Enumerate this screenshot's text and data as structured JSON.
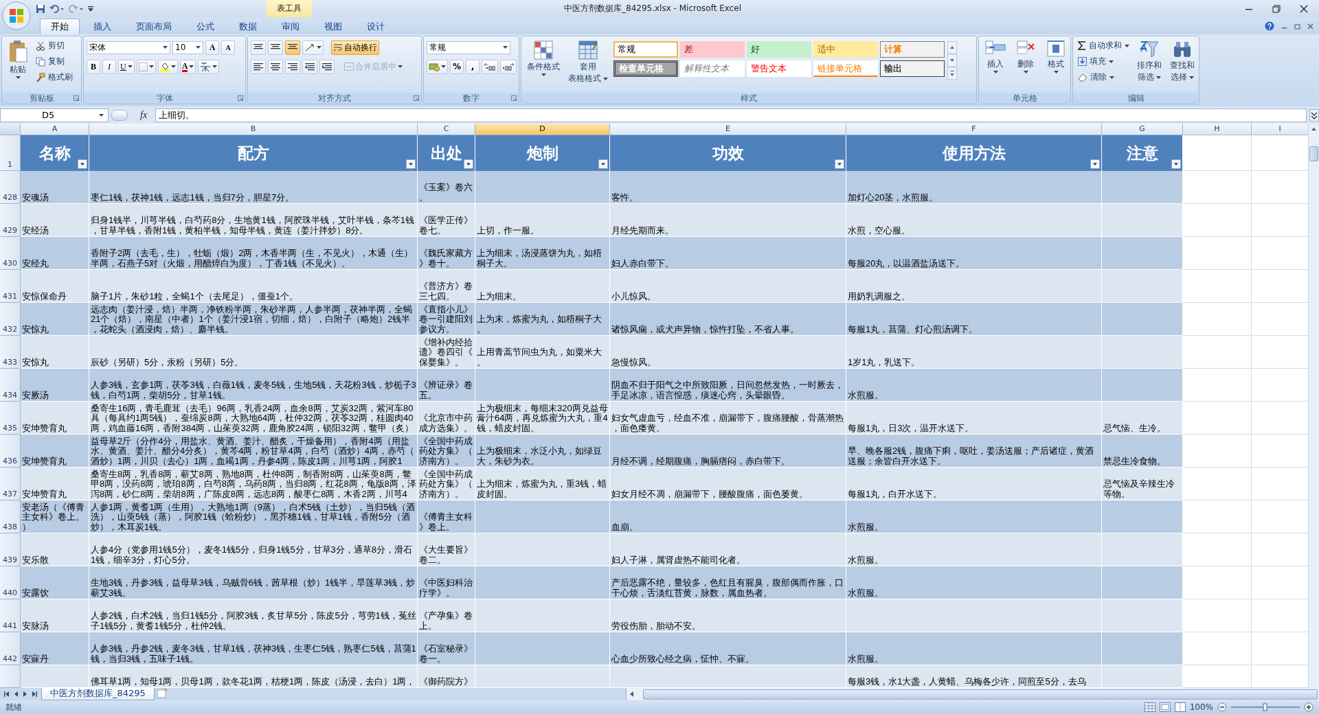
{
  "title_bar": {
    "title": "中医方剂数据库_84295.xlsx - Microsoft Excel",
    "contextual_group": "表工具"
  },
  "ribbon_tabs": [
    {
      "label": "开始",
      "selected": true
    },
    {
      "label": "插入",
      "selected": false
    },
    {
      "label": "页面布局",
      "selected": false
    },
    {
      "label": "公式",
      "selected": false
    },
    {
      "label": "数据",
      "selected": false
    },
    {
      "label": "审阅",
      "selected": false
    },
    {
      "label": "视图",
      "selected": false
    },
    {
      "label": "设计",
      "selected": false
    }
  ],
  "ribbon": {
    "clipboard": {
      "label": "剪贴板",
      "paste": "粘贴",
      "cut": "剪切",
      "copy": "复制",
      "format_painter": "格式刷"
    },
    "font": {
      "label": "字体",
      "font_name": "宋体",
      "font_size": "10",
      "grow": "A",
      "shrink": "A",
      "bold": "B",
      "italic": "I",
      "underline": "U",
      "font_color": "A"
    },
    "alignment": {
      "label": "对齐方式",
      "wrap_text": {
        "label": "自动换行",
        "on": true
      },
      "merge_center": {
        "label": "合并后居中",
        "disabled": true
      }
    },
    "number": {
      "label": "数字",
      "format": "常规",
      "percent": "%",
      "comma": ","
    },
    "styles": {
      "label": "样式",
      "conditional": "条件格式",
      "table_format": [
        "套用",
        "表格格式"
      ],
      "cell_styles": [
        {
          "label": "常规",
          "kind": "normal",
          "selected": true
        },
        {
          "label": "差",
          "kind": "bad",
          "selected": false
        },
        {
          "label": "好",
          "kind": "good",
          "selected": false
        },
        {
          "label": "适中",
          "kind": "neutral",
          "selected": false
        },
        {
          "label": "计算",
          "kind": "calculation",
          "selected": false
        },
        {
          "label": "检查单元格",
          "kind": "check",
          "selected": false
        },
        {
          "label": "解释性文本",
          "kind": "explanatory",
          "selected": false
        },
        {
          "label": "警告文本",
          "kind": "warning",
          "selected": false
        },
        {
          "label": "链接单元格",
          "kind": "linked",
          "selected": false
        },
        {
          "label": "输出",
          "kind": "output",
          "selected": false
        }
      ]
    },
    "cells": {
      "label": "单元格",
      "insert": "插入",
      "delete": "删除",
      "format": "格式"
    },
    "editing": {
      "label": "编辑",
      "autosum": "自动求和",
      "fill": "填充",
      "clear": "清除",
      "sort_filter": [
        "排序和",
        "筛选"
      ],
      "find_select": [
        "查找和",
        "选择"
      ]
    }
  },
  "formula_bar": {
    "name_box": "D5",
    "function_label": "fx",
    "value": "上细切。"
  },
  "column_letters": [
    {
      "letter": "A",
      "selected": false
    },
    {
      "letter": "B",
      "selected": false
    },
    {
      "letter": "C",
      "selected": false
    },
    {
      "letter": "D",
      "selected": true
    },
    {
      "letter": "E",
      "selected": false
    },
    {
      "letter": "F",
      "selected": false
    },
    {
      "letter": "G",
      "selected": false
    },
    {
      "letter": "H",
      "selected": false
    },
    {
      "letter": "I",
      "selected": false
    }
  ],
  "table": {
    "header_row_number": "1",
    "columns": [
      "名称",
      "配方",
      "出处",
      "炮制",
      "功效",
      "使用方法",
      "注意"
    ],
    "rows": [
      {
        "number": "428",
        "name": "安魂汤",
        "recipe": "枣仁1钱，茯神1钱，远志1钱，当归7分，胆星7分。",
        "source": "《玉案》卷六。",
        "efficacy": "客忤。",
        "usage": "加灯心20茎，水煎服。"
      },
      {
        "number": "429",
        "name": "安经汤",
        "recipe": "归身1钱半，川芎半钱，白芍药8分，生地黄1钱，阿胶珠半钱，艾叶半钱，条芩1钱，甘草半钱，香附1钱，黄柏半钱，知母半钱，黄连（姜汁拌炒）8分。",
        "source": "《医学正传》卷七。",
        "preparation": "上切，作一服。",
        "efficacy": "月经先期而来。",
        "usage": "水煎，空心服。"
      },
      {
        "number": "430",
        "name": "安经丸",
        "recipe": "香附子2两（去毛，生），牡蛎（煅）2两，木香半两（生，不见火），木通（生）半两，石燕子5对（火煅，用醋焠白为度），丁香1钱（不见火）。",
        "source": "《魏氏家藏方》卷十。",
        "preparation": "上为细末，汤浸蒸饼为丸，如梧桐子大。",
        "efficacy": "妇人赤白带下。",
        "usage": "每服20丸，以温酒盐汤送下。"
      },
      {
        "number": "431",
        "name": "安惊保命丹",
        "recipe": "脑子1片，朱砂1粒，全蝎1个（去尾足），僵蚕1个。",
        "source": "《普济方》卷三七四。",
        "preparation": "上为细末。",
        "efficacy": "小儿惊风。",
        "usage": "用奶乳调服之。"
      },
      {
        "number": "432",
        "name": "安惊丸",
        "recipe": "远志肉（姜汁浸，焙）半两，净铁粉半两，朱砂半两，人参半两，茯神半两，全蝎21个（焙），南星（中者）1个（姜汁浸1宿，切细，焙），白附子（略炮）2钱半，花蛇头（酒浸肉，焙）、麝半钱。",
        "source": "《直指小儿》卷一引建阳刘参议方。",
        "preparation": "上为末，炼蜜为丸，如梧桐子大。",
        "efficacy": "诸惊风痫，或犬声异物，惊忤打坠，不省人事。",
        "usage": "每服1丸，菖蒲、灯心煎汤调下。"
      },
      {
        "number": "433",
        "name": "安惊丸",
        "recipe": "辰砂（另研）5分，汞粉（另研）5分。",
        "source": "《增补内经拾遗》卷四引《保婴集》。",
        "preparation": "上用青蒿节间虫为丸，如粟米大。",
        "efficacy": "急慢惊风。",
        "usage": "1岁1丸，乳送下。"
      },
      {
        "number": "434",
        "name": "安厥汤",
        "recipe": "人参3钱，玄参1两，茯苓3钱，白薇1钱，麦冬5钱，生地5钱，天花粉3钱，炒栀子3钱，白芍1两，柴胡5分，甘草1钱。",
        "source": "《辨证录》卷五。",
        "efficacy": "阴血不归于阳气之中所致阳厥，日间忽然发热，一时厥去，手足冰凉，语言惶惑，痰迷心窍，头晕眼昏。",
        "usage": "水煎服。"
      },
      {
        "number": "435",
        "name": "安坤赞育丸",
        "recipe": "桑寄生16两，青毛鹿茸（去毛）96两，乳香24两，血余8两，艾炭32两，紫河车80具（每具约1两5钱），蚕绵炭8两，大熟地64两，杜仲32两，茯苓32两，桂圆肉40两，鸡血藤16两，香附384两，山茱萸32两，鹿角胶24两，锁阳32两，鳖甲（炙）",
        "source": "《北京市中药成方选集》。",
        "preparation": "上为极细末，每细末320两兑益母膏汁64两，再兑炼蜜为大丸，重4钱，蜡皮封固。",
        "efficacy": "妇女气虚血亏，经血不准，崩漏带下，腹痛腰酸，骨蒸潮热，面色痿黄。",
        "usage": "每服1丸，日3次，温开水送下。",
        "caution": "忌气恼、生冷。"
      },
      {
        "number": "436",
        "name": "安坤赞育丸",
        "recipe": "益母草2斤（分作4分，用盐水、黄酒、姜汁、醋炙，干燥备用），香附4两（用盐水、黄酒、姜汁、醋分4分炙），黄芩4两，粉甘草4两，白芍（酒炒）4两，赤芍（酒炒）1两，川贝（去心）1两，血竭1两，丹参4两，陈皮1两，川芎1两，阿胶1",
        "source": "《全国中药成药处方集》（济南方）。",
        "preparation": "上为极细末，水泛小丸，如绿豆大，朱砂为衣。",
        "efficacy": "月经不调，经期腹痛，胸膈痞闷，赤白带下。",
        "usage": "早、晚各服2钱，腹痛下痢，呕吐，姜汤送服；产后诸症，黄酒送服；余皆白开水送下。",
        "caution": "禁忌生冷食物。"
      },
      {
        "number": "437",
        "name": "安坤赞育丸",
        "recipe": "桑寄生8两，乳香8两，蕲艾8两，熟地8两，杜仲8两，制香附8两，山茱萸8两，鳖甲8两，没药8两，琥珀8两，白芍8两，乌药8两，当归8两，红花8两，龟版8两，泽泻8两，砂仁8两，柴胡8两，广陈皮8两，远志8两，酸枣仁8两，木香2两，川芎4",
        "source": "《全国中药成药处方集》（济南方）。",
        "preparation": "上为细末，炼蜜为丸，重3钱，蜡皮封固。",
        "efficacy": "妇女月经不凋，崩漏带下，腰酸腹痛，面色萎黄。",
        "usage": "每服1丸，白开水送下。",
        "caution": "忌气恼及辛辣生冷等物。"
      },
      {
        "number": "438",
        "name": "安老汤（《傅青主女科》卷上。）",
        "recipe": "人参1两，黄耆1两（生用），大熟地1两（9蒸），白术5钱（土炒），当归5钱（酒洗），山萸5钱（蒸），阿胶1钱（蛤粉炒），黑芥穗1钱，甘草1钱，香附5分（酒炒），木耳炭1钱。",
        "source": "《傅青主女科》卷上。",
        "efficacy": "血崩。",
        "usage": "水煎服。"
      },
      {
        "number": "439",
        "name": "安乐散",
        "recipe": "人参4分（党参用1钱5分），麦冬1钱5分，归身1钱5分，甘草3分，通草8分，滑石1钱，细辛3分，灯心5分。",
        "source": "《大生要旨》卷二。",
        "efficacy": "妇人子淋，属肾虚热不能司化者。",
        "usage": "水煎服。"
      },
      {
        "number": "440",
        "name": "安露饮",
        "recipe": "生地3钱，丹参3钱，益母草3钱，乌贼骨6钱，茜草根（炒）1钱半，旱莲草3钱，炒蕲艾3钱。",
        "source": "《中医妇科治疗学》。",
        "efficacy": "产后恶露不绝，量较多，色红且有腥臭，腹部偶而作胀，口干心烦，舌淡红苔黄，脉数，属血热者。",
        "usage": "水煎服。"
      },
      {
        "number": "441",
        "name": "安脉汤",
        "recipe": "人参2钱，白术2钱，当归1钱5分，阿胶3钱，炙甘草5分，陈皮5分，芎劳1钱，菟丝子1钱5分，黄耆1钱5分，杜仲2钱。",
        "source": "《产孕集》卷上。",
        "efficacy": "劳役伤胎，胎动不安。"
      },
      {
        "number": "442",
        "name": "安寐丹",
        "recipe": "人参3钱，丹参2钱，麦冬3钱，甘草1钱，茯神3钱，生枣仁5钱，熟枣仁5钱，菖蒲1钱，当归3钱，五味子1钱。",
        "source": "《石室秘录》卷一。",
        "efficacy": "心血少所致心经之病，怔忡、不寐。",
        "usage": "水煎服。"
      }
    ],
    "cut_row": {
      "recipe": "佛耳草1两，知母1两，贝母1两，款冬花1两，桔梗1两，陈皮（汤浸，去白）1两，",
      "source": "《御药院方》",
      "usage": "每服3钱，水1大盏，人黄蜡、乌梅各少许，同煎至5分，去乌"
    }
  },
  "sheet_tabs": [
    {
      "label": "中医方剂数据库_84295",
      "selected": true
    }
  ],
  "status_bar": {
    "status": "就绪",
    "zoom": "100%"
  }
}
